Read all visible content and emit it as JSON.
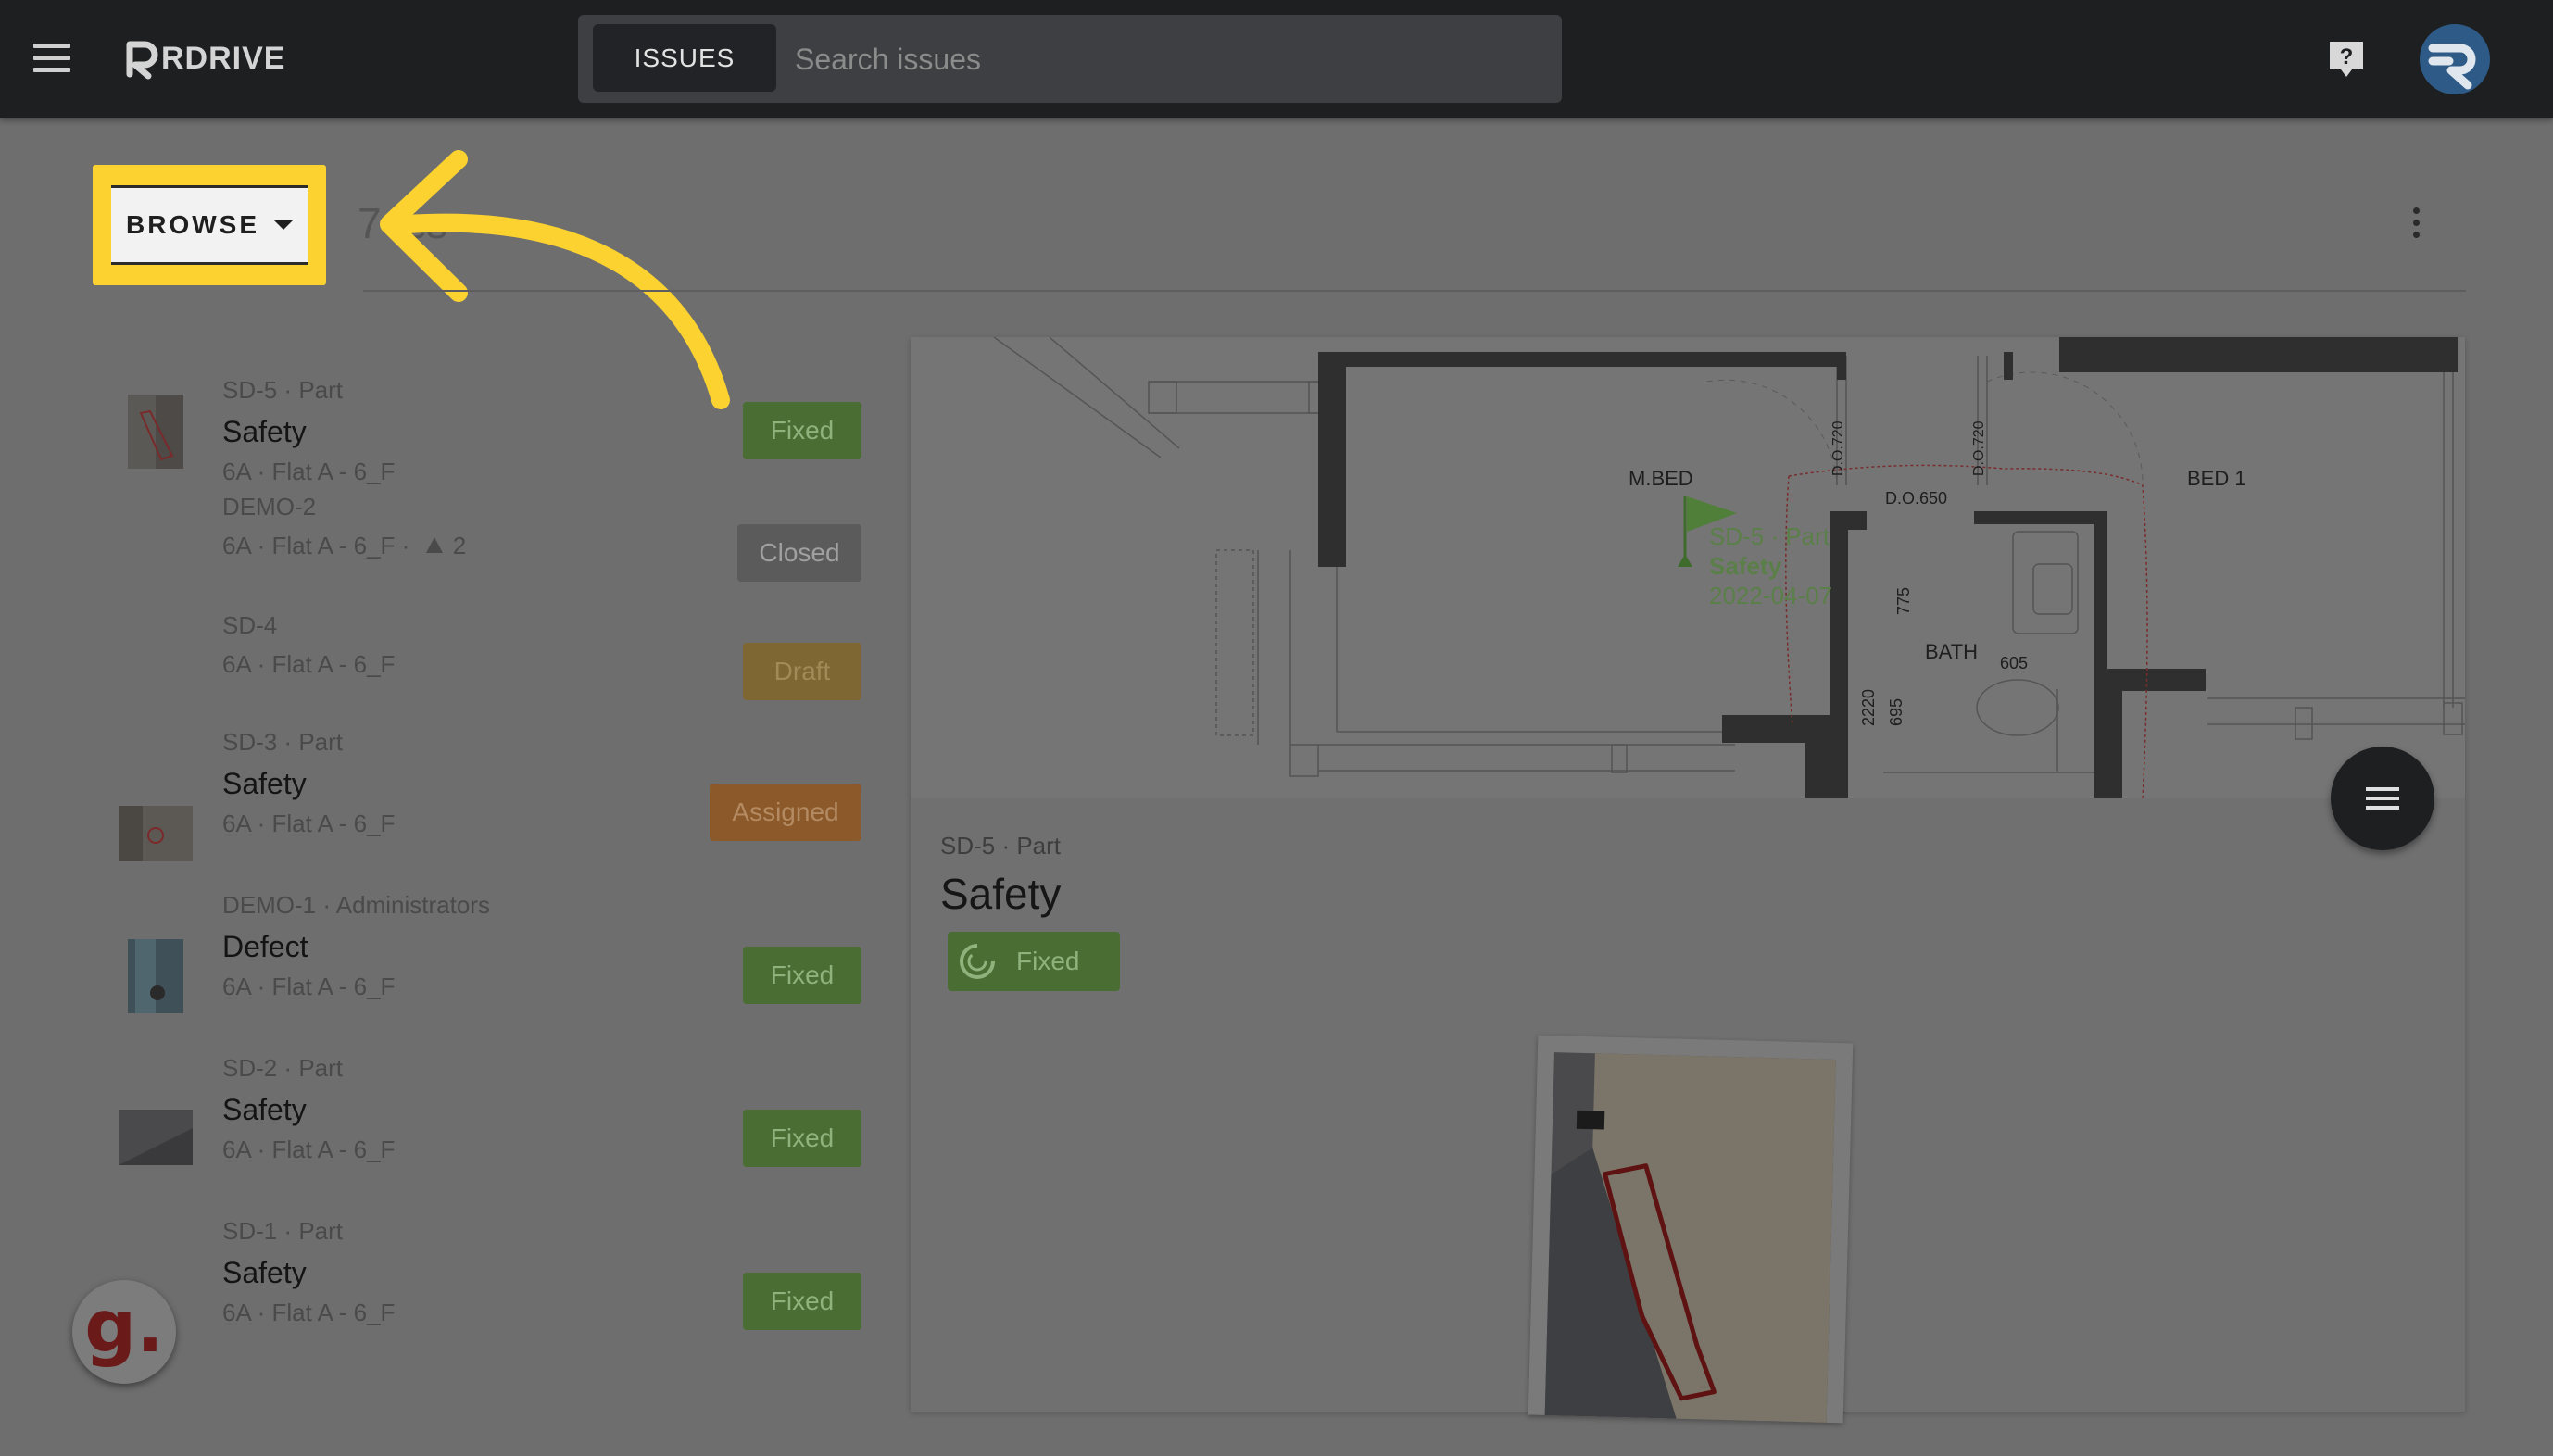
{
  "header": {
    "logo_text": "RDRIVE",
    "search_chip": "ISSUES",
    "search_placeholder": "Search issues"
  },
  "toolbar": {
    "browse_label": "BROWSE",
    "count_fragment": "7 Iss"
  },
  "issues": [
    {
      "meta": "SD-5 · Part",
      "title": "Safety",
      "location": "6A · Flat A - 6_F",
      "status": "Fixed"
    },
    {
      "meta": "DEMO-2",
      "title": "",
      "location": "6A · Flat A - 6_F ·",
      "extra": "2",
      "status": "Closed"
    },
    {
      "meta": "SD-4",
      "title": "",
      "location": "6A · Flat A - 6_F",
      "status": "Draft"
    },
    {
      "meta": "SD-3 · Part",
      "title": "Safety",
      "location": "6A · Flat A - 6_F",
      "status": "Assigned"
    },
    {
      "meta": "DEMO-1 · Administrators",
      "title": "Defect",
      "location": "6A · Flat A - 6_F",
      "status": "Fixed"
    },
    {
      "meta": "SD-2 · Part",
      "title": "Safety",
      "location": "6A · Flat A - 6_F",
      "status": "Fixed"
    },
    {
      "meta": "SD-1 · Part",
      "title": "Safety",
      "location": "6A · Flat A - 6_F",
      "status": "Fixed"
    }
  ],
  "detail": {
    "meta": "SD-5 · Part",
    "title": "Safety",
    "status": "Fixed",
    "plan_labels": {
      "mbed": "M.BED",
      "bed1": "BED 1",
      "bath": "BATH",
      "do650": "D.O.650",
      "do720": "D.O.720",
      "n775": "775",
      "n605": "605",
      "n2220": "2220",
      "n695": "695",
      "pin_id": "SD-5 · Part",
      "pin_title": "Safety",
      "pin_date": "2022-04-07"
    }
  },
  "colors": {
    "topbar": "#1e1f21",
    "highlight": "#fbd230",
    "fixed": "#4a6d34",
    "closed": "#5b5b5b",
    "draft": "#7f6733",
    "assigned": "#8c5a2a"
  }
}
